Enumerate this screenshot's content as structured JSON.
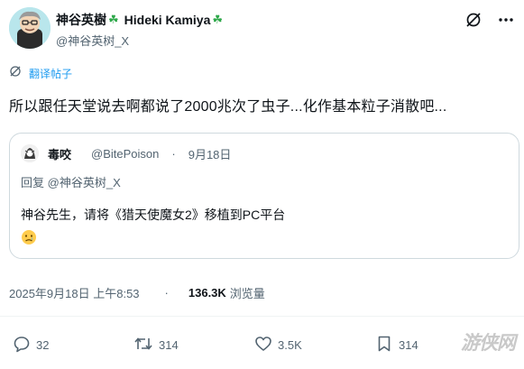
{
  "author": {
    "display_name": "神谷英樹",
    "display_name_en": "Hideki Kamiya",
    "handle": "@神谷英树_X",
    "clover": "☘"
  },
  "translate": {
    "label": "翻译帖子"
  },
  "tweet": {
    "text": "所以跟任天堂说去啊都说了2000兆次了虫子...化作基本粒子消散吧..."
  },
  "quote": {
    "author_name": "毒咬",
    "author_handle": "@BitePoison",
    "separator": "·",
    "date": "9月18日",
    "reply_label": "回复",
    "reply_to": "@神谷英树_X",
    "text": "神谷先生，请将《猎天使魔女2》移植到PC平台"
  },
  "meta": {
    "timestamp": "2025年9月18日 上午8:53",
    "separator": "·",
    "views_count": "136.3K",
    "views_label": "浏览量"
  },
  "actions": {
    "reply_count": "32",
    "retweet_count": "314",
    "like_count": "3.5K",
    "bookmark_count": "314"
  },
  "watermark": "游侠网",
  "colors": {
    "accent": "#1d9bf0",
    "muted": "#536471",
    "border": "#cfd9de"
  }
}
